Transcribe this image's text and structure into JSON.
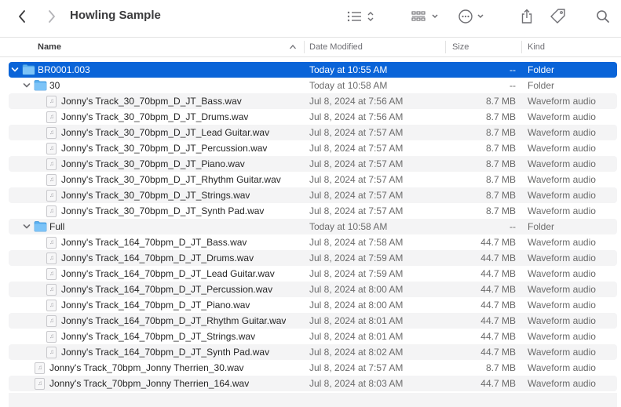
{
  "window": {
    "title": "Howling Sample",
    "icons": {
      "back": "chevron-left-icon",
      "forward": "chevron-right-icon",
      "view": "list-view-icon",
      "group": "grid-group-icon",
      "action": "ellipsis-circle-icon",
      "share": "share-icon",
      "tag": "tag-icon",
      "search": "search-icon"
    }
  },
  "columns": {
    "name": "Name",
    "date": "Date Modified",
    "size": "Size",
    "kind": "Kind"
  },
  "colors": {
    "selection": "#0a64d8",
    "folder": "#5ab0f0",
    "stripe": "#f4f4f5"
  },
  "rows": [
    {
      "name": "BR0001.003",
      "date": "Today at 10:55 AM",
      "size": "--",
      "kind": "Folder",
      "type": "folder",
      "level": 0,
      "expanded": true,
      "selected": true
    },
    {
      "name": "30",
      "date": "Today at 10:58 AM",
      "size": "--",
      "kind": "Folder",
      "type": "folder",
      "level": 1,
      "expanded": true
    },
    {
      "name": "Jonny's Track_30_70bpm_D_JT_Bass.wav",
      "date": "Jul 8, 2024 at 7:56 AM",
      "size": "8.7 MB",
      "kind": "Waveform audio",
      "type": "audio",
      "level": 2
    },
    {
      "name": "Jonny's Track_30_70bpm_D_JT_Drums.wav",
      "date": "Jul 8, 2024 at 7:56 AM",
      "size": "8.7 MB",
      "kind": "Waveform audio",
      "type": "audio",
      "level": 2
    },
    {
      "name": "Jonny's Track_30_70bpm_D_JT_Lead Guitar.wav",
      "date": "Jul 8, 2024 at 7:57 AM",
      "size": "8.7 MB",
      "kind": "Waveform audio",
      "type": "audio",
      "level": 2
    },
    {
      "name": "Jonny's Track_30_70bpm_D_JT_Percussion.wav",
      "date": "Jul 8, 2024 at 7:57 AM",
      "size": "8.7 MB",
      "kind": "Waveform audio",
      "type": "audio",
      "level": 2
    },
    {
      "name": "Jonny's Track_30_70bpm_D_JT_Piano.wav",
      "date": "Jul 8, 2024 at 7:57 AM",
      "size": "8.7 MB",
      "kind": "Waveform audio",
      "type": "audio",
      "level": 2
    },
    {
      "name": "Jonny's Track_30_70bpm_D_JT_Rhythm Guitar.wav",
      "date": "Jul 8, 2024 at 7:57 AM",
      "size": "8.7 MB",
      "kind": "Waveform audio",
      "type": "audio",
      "level": 2
    },
    {
      "name": "Jonny's Track_30_70bpm_D_JT_Strings.wav",
      "date": "Jul 8, 2024 at 7:57 AM",
      "size": "8.7 MB",
      "kind": "Waveform audio",
      "type": "audio",
      "level": 2
    },
    {
      "name": "Jonny's Track_30_70bpm_D_JT_Synth Pad.wav",
      "date": "Jul 8, 2024 at 7:57 AM",
      "size": "8.7 MB",
      "kind": "Waveform audio",
      "type": "audio",
      "level": 2
    },
    {
      "name": "Full",
      "date": "Today at 10:58 AM",
      "size": "--",
      "kind": "Folder",
      "type": "folder",
      "level": 1,
      "expanded": true
    },
    {
      "name": "Jonny's Track_164_70bpm_D_JT_Bass.wav",
      "date": "Jul 8, 2024 at 7:58 AM",
      "size": "44.7 MB",
      "kind": "Waveform audio",
      "type": "audio",
      "level": 2
    },
    {
      "name": "Jonny's Track_164_70bpm_D_JT_Drums.wav",
      "date": "Jul 8, 2024 at 7:59 AM",
      "size": "44.7 MB",
      "kind": "Waveform audio",
      "type": "audio",
      "level": 2
    },
    {
      "name": "Jonny's Track_164_70bpm_D_JT_Lead Guitar.wav",
      "date": "Jul 8, 2024 at 7:59 AM",
      "size": "44.7 MB",
      "kind": "Waveform audio",
      "type": "audio",
      "level": 2
    },
    {
      "name": "Jonny's Track_164_70bpm_D_JT_Percussion.wav",
      "date": "Jul 8, 2024 at 8:00 AM",
      "size": "44.7 MB",
      "kind": "Waveform audio",
      "type": "audio",
      "level": 2
    },
    {
      "name": "Jonny's Track_164_70bpm_D_JT_Piano.wav",
      "date": "Jul 8, 2024 at 8:00 AM",
      "size": "44.7 MB",
      "kind": "Waveform audio",
      "type": "audio",
      "level": 2
    },
    {
      "name": "Jonny's Track_164_70bpm_D_JT_Rhythm Guitar.wav",
      "date": "Jul 8, 2024 at 8:01 AM",
      "size": "44.7 MB",
      "kind": "Waveform audio",
      "type": "audio",
      "level": 2
    },
    {
      "name": "Jonny's Track_164_70bpm_D_JT_Strings.wav",
      "date": "Jul 8, 2024 at 8:01 AM",
      "size": "44.7 MB",
      "kind": "Waveform audio",
      "type": "audio",
      "level": 2
    },
    {
      "name": "Jonny's Track_164_70bpm_D_JT_Synth Pad.wav",
      "date": "Jul 8, 2024 at 8:02 AM",
      "size": "44.7 MB",
      "kind": "Waveform audio",
      "type": "audio",
      "level": 2
    },
    {
      "name": "Jonny's Track_70bpm_Jonny Therrien_30.wav",
      "date": "Jul 8, 2024 at 7:57 AM",
      "size": "8.7 MB",
      "kind": "Waveform audio",
      "type": "audio",
      "level": 1
    },
    {
      "name": "Jonny's Track_70bpm_Jonny Therrien_164.wav",
      "date": "Jul 8, 2024 at 8:03 AM",
      "size": "44.7 MB",
      "kind": "Waveform audio",
      "type": "audio",
      "level": 1
    }
  ]
}
